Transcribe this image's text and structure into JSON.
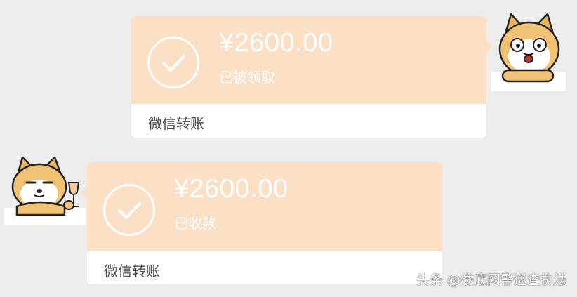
{
  "colors": {
    "background": "#ededed",
    "transfer_top": "#fbe0c6",
    "transfer_bottom": "#ffffff",
    "text_white": "#ffffff",
    "footer_text": "#4a4a4a"
  },
  "messages": [
    {
      "side": "right",
      "amount": "¥2600.00",
      "status": "已被领取",
      "footer": "微信转账",
      "icon": "check-circle-icon",
      "avatar": "shiba-dog-avatar"
    },
    {
      "side": "left",
      "amount": "¥2600.00",
      "status": "已收款",
      "footer": "微信转账",
      "icon": "check-circle-icon",
      "avatar": "shiba-dog-wine-avatar"
    }
  ],
  "watermark": "头条 @娄底网警巡查执法"
}
